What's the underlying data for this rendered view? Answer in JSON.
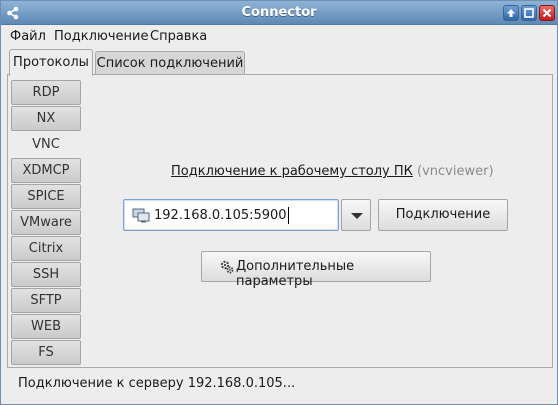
{
  "window": {
    "title": "Connector"
  },
  "menu": {
    "items": [
      "Файл",
      "Подключение",
      "Справка"
    ]
  },
  "tabs": [
    {
      "label": "Протоколы",
      "active": true
    },
    {
      "label": "Список подключений",
      "active": false
    }
  ],
  "protocols": {
    "items": [
      "RDP",
      "NX",
      "VNC",
      "XDMCP",
      "SPICE",
      "VMware",
      "Citrix",
      "SSH",
      "SFTP",
      "WEB",
      "FS"
    ],
    "selected": "VNC"
  },
  "main": {
    "heading_link": "Подключение к рабочему столу ПК",
    "heading_hint": "(vncviewer)",
    "address_value": "192.168.0.105:5900",
    "connect_label": "Подключение",
    "params_label": "Дополнительные параметры"
  },
  "status": {
    "text": "Подключение к серверу 192.168.0.105..."
  },
  "colors": {
    "titlebar": "#6f97c2",
    "focus_border": "#7ba4d4",
    "close_button": "#d32f2f"
  },
  "icons": {
    "app": "share-icon",
    "address": "monitor-icon",
    "params": "gears-icon",
    "dropdown": "chevron-down-icon"
  }
}
